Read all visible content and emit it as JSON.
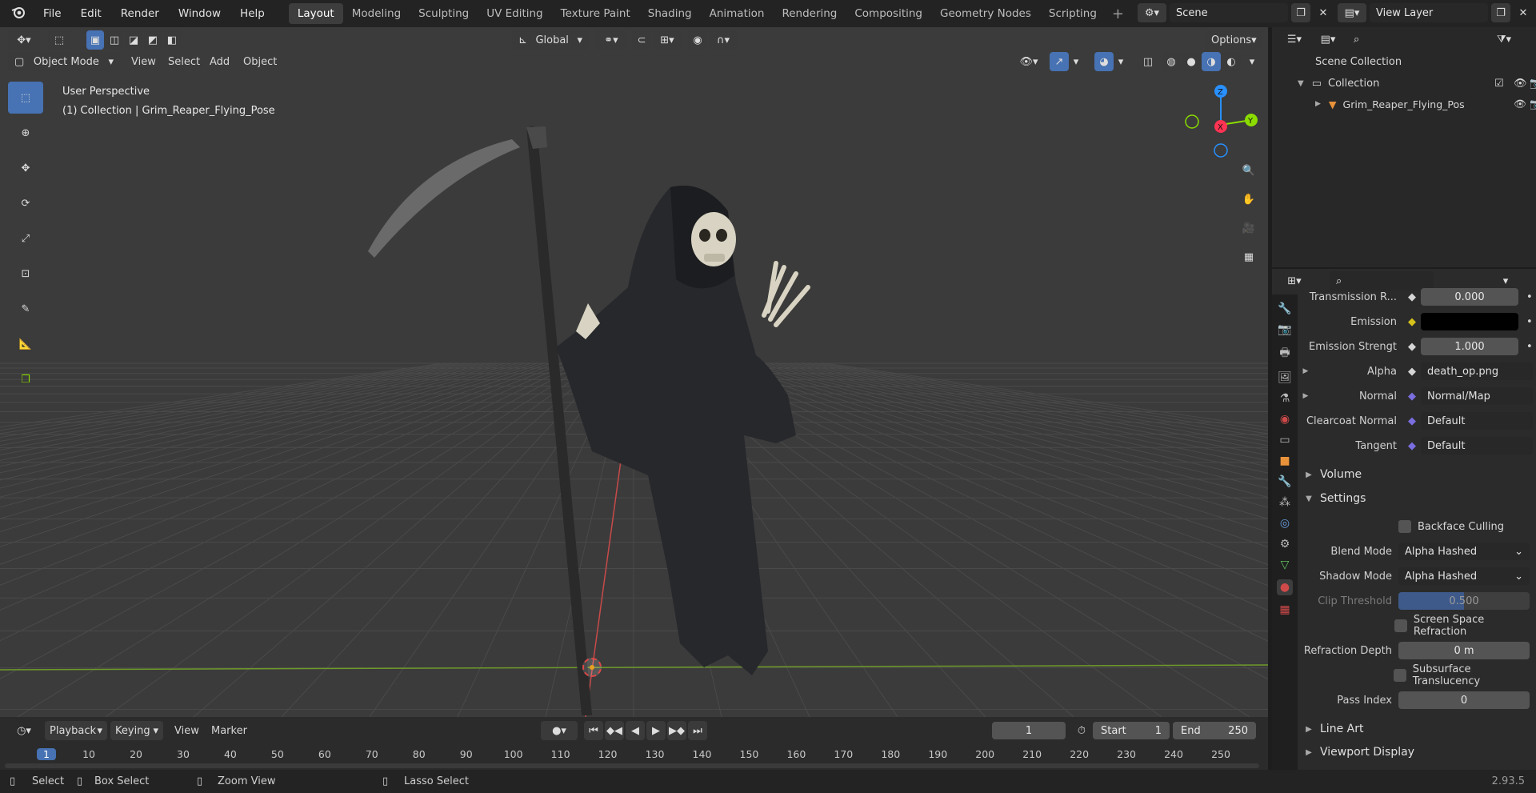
{
  "menu": {
    "file": "File",
    "edit": "Edit",
    "render": "Render",
    "window": "Window",
    "help": "Help"
  },
  "workspaces": [
    "Layout",
    "Modeling",
    "Sculpting",
    "UV Editing",
    "Texture Paint",
    "Shading",
    "Animation",
    "Rendering",
    "Compositing",
    "Geometry Nodes",
    "Scripting"
  ],
  "active_workspace": "Layout",
  "scene": {
    "name": "Scene",
    "view_layer": "View Layer"
  },
  "viewport": {
    "transform_orientation": "Global",
    "options": "Options",
    "mode": "Object Mode",
    "menus": [
      "View",
      "Select",
      "Add",
      "Object"
    ],
    "overlay_title": "User Perspective",
    "overlay_sub": "(1) Collection | Grim_Reaper_Flying_Pose",
    "gizmo": {
      "z": "Z",
      "y": "Y",
      "x": "X"
    }
  },
  "outliner": {
    "scene_collection": "Scene Collection",
    "collection": "Collection",
    "object": "Grim_Reaper_Flying_Pos"
  },
  "properties": {
    "transmission_label": "Transmission R...",
    "transmission_value": "0.000",
    "emission_label": "Emission",
    "emission_color": "#000000",
    "emission_strength_label": "Emission Strengt",
    "emission_strength_value": "1.000",
    "alpha_label": "Alpha",
    "alpha_value": "death_op.png",
    "normal_label": "Normal",
    "normal_value": "Normal/Map",
    "clearcoat_label": "Clearcoat Normal",
    "clearcoat_value": "Default",
    "tangent_label": "Tangent",
    "tangent_value": "Default",
    "volume": "Volume",
    "settings": "Settings",
    "backface": "Backface Culling",
    "blend_label": "Blend Mode",
    "blend_value": "Alpha Hashed",
    "shadow_label": "Shadow Mode",
    "shadow_value": "Alpha Hashed",
    "clip_label": "Clip Threshold",
    "clip_value": "0.500",
    "ssr": "Screen Space Refraction",
    "refr_label": "Refraction Depth",
    "refr_value": "0 m",
    "sss": "Subsurface Translucency",
    "pass_label": "Pass Index",
    "pass_value": "0",
    "line_art": "Line Art",
    "viewport_display": "Viewport Display"
  },
  "timeline": {
    "menus": [
      "Playback",
      "Keying",
      "View",
      "Marker"
    ],
    "current_frame": "1",
    "start_label": "Start",
    "start": "1",
    "end_label": "End",
    "end": "250",
    "ticks": [
      "1",
      "10",
      "20",
      "30",
      "40",
      "50",
      "60",
      "70",
      "80",
      "90",
      "100",
      "110",
      "120",
      "130",
      "140",
      "150",
      "160",
      "170",
      "180",
      "190",
      "200",
      "210",
      "220",
      "230",
      "240",
      "250"
    ]
  },
  "status": {
    "select": "Select",
    "box_select": "Box Select",
    "zoom_view": "Zoom View",
    "lasso_select": "Lasso Select",
    "version": "2.93.5"
  },
  "colors": {
    "accent": "#4772b3",
    "x_axis": "#ff3352",
    "y_axis": "#8bdc00",
    "z_axis": "#2890ff"
  }
}
